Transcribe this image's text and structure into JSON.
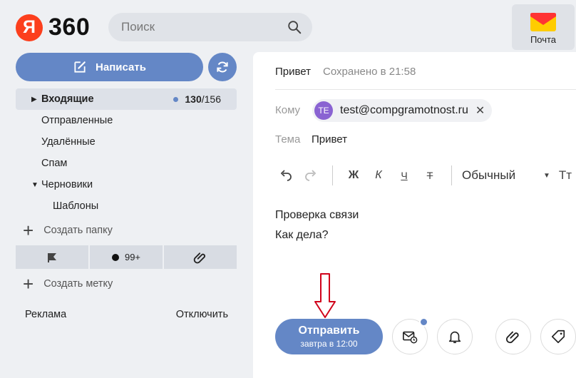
{
  "header": {
    "logo_letter": "Я",
    "logo_text": "360",
    "search_placeholder": "Поиск",
    "app_label": "Почта"
  },
  "sidebar": {
    "compose_label": "Написать",
    "folders": [
      {
        "label": "Входящие",
        "unread": "130",
        "total": "156"
      },
      {
        "label": "Отправленные"
      },
      {
        "label": "Удалённые"
      },
      {
        "label": "Спам"
      },
      {
        "label": "Черновики"
      },
      {
        "label": "Шаблоны"
      }
    ],
    "total_separator": "/",
    "create_folder": "Создать папку",
    "labels_unread": "99+",
    "create_label": "Создать метку",
    "ad_label": "Реклама",
    "ad_disable": "Отключить"
  },
  "compose": {
    "title": "Привет",
    "saved_status": "Сохранено в 21:58",
    "to_label": "Кому",
    "recipient_initials": "TE",
    "recipient_email": "test@compgramotnost.ru",
    "subject_label": "Тема",
    "subject_value": "Привет",
    "toolbar": {
      "bold": "Ж",
      "italic": "К",
      "underline": "Ч",
      "strike": "Т",
      "style": "Обычный",
      "size_icon": "Тт"
    },
    "body_lines": [
      "Проверка связи",
      "Как дела?"
    ],
    "send_label": "Отправить",
    "send_schedule": "завтра в 12:00"
  },
  "colors": {
    "accent": "#6487c6",
    "logo_red": "#fc3f1d",
    "avatar": "#8a63d2",
    "annotation_arrow": "#d0021b"
  }
}
